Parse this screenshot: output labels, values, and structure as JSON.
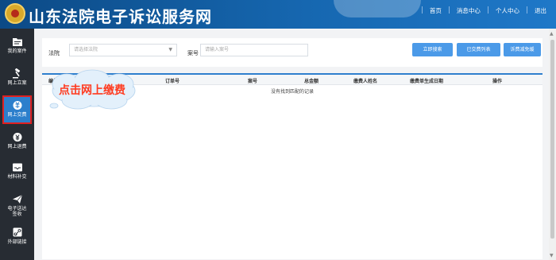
{
  "header": {
    "site_title": "山东法院电子诉讼服务网",
    "nav": [
      "首页",
      "消息中心",
      "个人中心",
      "退出"
    ]
  },
  "sidebar": {
    "items": [
      {
        "label": "我的案件",
        "icon": "folder-icon"
      },
      {
        "label": "网上立案",
        "icon": "gavel-icon"
      },
      {
        "label": "网上交费",
        "icon": "payment-icon",
        "active": true
      },
      {
        "label": "网上退费",
        "icon": "yuan-icon"
      },
      {
        "label": "材料补交",
        "icon": "inbox-icon"
      },
      {
        "label": "电子送达\n签收",
        "icon": "paper-plane-icon"
      },
      {
        "label": "外部链接",
        "icon": "link-icon"
      }
    ]
  },
  "filter": {
    "court_label": "法院",
    "court_placeholder": "请选择法院",
    "case_label": "案号",
    "case_placeholder": "请输入案号",
    "buttons": [
      "立即搜索",
      "已交费列表",
      "诉费减免缓"
    ]
  },
  "table": {
    "headers": [
      "编号",
      "订单号",
      "案号",
      "总金额",
      "缴费人姓名",
      "缴费单生成日期",
      "操作"
    ],
    "empty_message": "没有找到匹配的记录"
  },
  "callout": {
    "text": "点击网上缴费"
  },
  "colors": {
    "header_blue": "#1667b0",
    "sidebar_dark": "#272c33",
    "active_item": "#2c7fcc",
    "highlight_red": "#e02020",
    "button_blue": "#4b9ae8",
    "callout_text": "#ff3b20"
  }
}
